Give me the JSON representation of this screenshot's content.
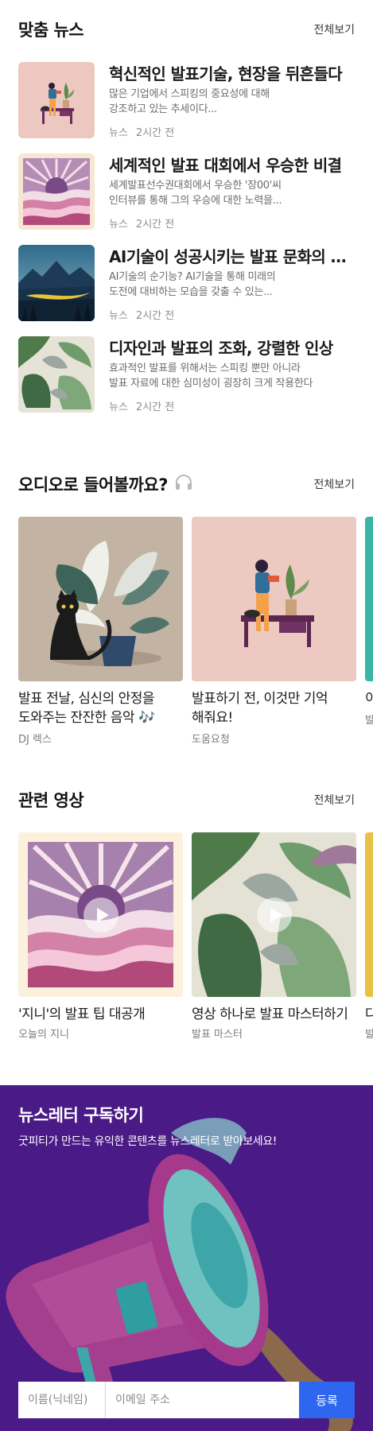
{
  "news": {
    "title": "맞춤 뉴스",
    "see_all": "전체보기",
    "items": [
      {
        "title": "혁신적인 발표기술, 현장을 뒤흔들다",
        "desc1": "많은 기업에서 스피킹의 중요성에 대해",
        "desc2": "강조하고 있는 추세이다...",
        "category": "뉴스",
        "time": "2시간 전"
      },
      {
        "title": "세계적인 발표 대회에서 우승한 비결",
        "desc1": "세계발표선수권대회에서 우승한 '장00'씨",
        "desc2": "인터뷰를 통해 그의 우승에 대한 노력을...",
        "category": "뉴스",
        "time": "2시간 전"
      },
      {
        "title": "AI기술이 성공시키는 발표 문화의 변화",
        "desc1": "AI기술의 순기능? AI기술을 통해 미래의",
        "desc2": "도전에 대비하는 모습을 갖출 수 있는...",
        "category": "뉴스",
        "time": "2시간 전"
      },
      {
        "title": "디자인과 발표의 조화, 강렬한 인상",
        "desc1": "효과적인 발표를 위해서는 스피킹 뿐만 아니라",
        "desc2": "발표 자료에 대한 심미성이 굉장히 크게 작용한다",
        "category": "뉴스",
        "time": "2시간 전"
      }
    ]
  },
  "audio": {
    "title": "오디오로 들어볼까요?",
    "icon": "headphones-icon",
    "see_all": "전체보기",
    "items": [
      {
        "title_line1": "발표 전날, 심신의 안정을",
        "title_line2": "도와주는 잔잔한 음악 🎶",
        "author": "DJ 렉스"
      },
      {
        "title_line1": "발표하기 전, 이것만 기억",
        "title_line2": "해줘요!",
        "author": "도움요청"
      },
      {
        "title_line1": "이",
        "title_line2": "",
        "author": "발"
      }
    ]
  },
  "video": {
    "title": "관련 영상",
    "see_all": "전체보기",
    "items": [
      {
        "title": "'지니'의 발표 팁 대공개",
        "author": "오늘의 지니"
      },
      {
        "title": "영상 하나로 발표 마스터하기",
        "author": "발표 마스터"
      },
      {
        "title": "다",
        "author": "발"
      }
    ]
  },
  "newsletter": {
    "title": "뉴스레터 구독하기",
    "desc": "굿피티가 만드는 유익한 콘텐츠를 뉴스레터로 받아보세요!",
    "name_placeholder": "이름(닉네임)",
    "email_placeholder": "이메일 주소",
    "submit_label": "등록",
    "bg_color": "#4a1a86",
    "button_color": "#2f66f0"
  }
}
